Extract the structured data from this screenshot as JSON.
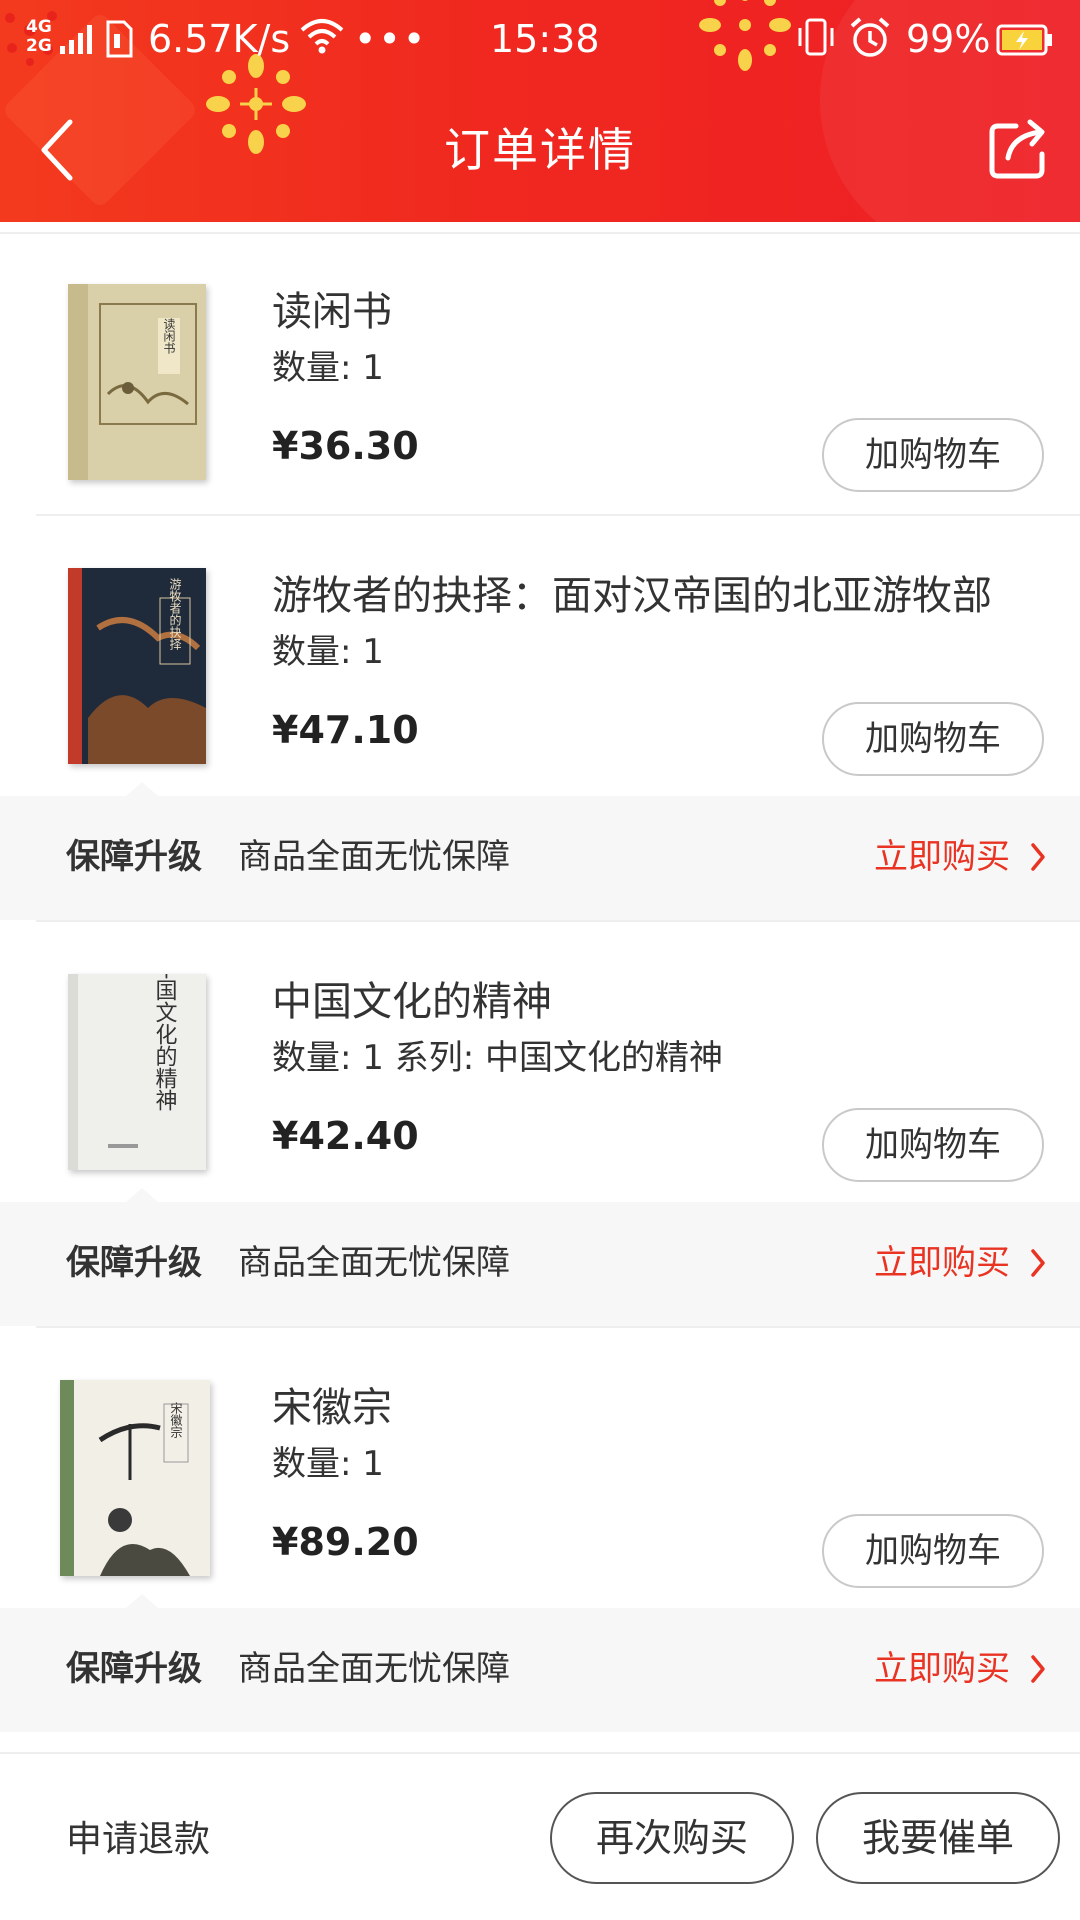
{
  "status_bar": {
    "network_top": "4G",
    "network_bottom": "2G",
    "speed": "6.57K/s",
    "dots": "•••",
    "time": "15:38",
    "battery_pct": "99%",
    "icons": [
      "signal-icon",
      "sim-icon",
      "wifi-icon",
      "vibrate-icon",
      "alarm-icon",
      "battery-charging-icon"
    ]
  },
  "header": {
    "title": "订单详情",
    "background_color": "#f0281f",
    "back_icon": "chevron-left-icon",
    "share_icon": "share-icon"
  },
  "items": [
    {
      "title": "读闲书",
      "qty": "数量: 1",
      "price": "¥36.30",
      "cart_label": "加购物车",
      "cover_title": "读闲书"
    },
    {
      "title": "游牧者的抉择：面对汉帝国的北亚游牧部",
      "qty": "数量: 1",
      "price": "¥47.10",
      "cart_label": "加购物车",
      "cover_title": "游牧者的抉择"
    },
    {
      "title": "中国文化的精神",
      "qty": "数量: 1 系列: 中国文化的精神",
      "price": "¥42.40",
      "cart_label": "加购物车",
      "cover_title": "中国文化的精神"
    },
    {
      "title": "宋徽宗",
      "qty": "数量: 1",
      "price": "¥89.20",
      "cart_label": "加购物车",
      "cover_title": "宋徽宗"
    }
  ],
  "guarantee": {
    "label": "保障升级",
    "desc": "商品全面无忧保障",
    "buy": "立即购买",
    "accent_color": "#e93323"
  },
  "bottom_bar": {
    "refund": "申请退款",
    "rebuy": "再次购买",
    "urge": "我要催单"
  }
}
